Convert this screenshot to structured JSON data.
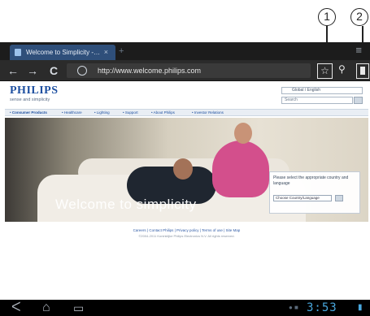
{
  "callouts": [
    "1",
    "2"
  ],
  "browser": {
    "tab_title": "Welcome to Simplicity -…",
    "tab_close": "×",
    "new_tab": "+",
    "overflow": "≡",
    "back": "←",
    "forward": "→",
    "reload": "C",
    "url": "http://www.welcome.philips.com",
    "bookmark_star": "☆",
    "search": "⚲"
  },
  "page": {
    "logo": "PHILIPS",
    "tagline": "sense and simplicity",
    "country_select": "Global / English",
    "search_placeholder": "Search",
    "nav": [
      "• Consumer Products",
      "• Healthcare",
      "• Lighting",
      "• Support",
      "• About Philips",
      "• Investor Relations"
    ],
    "headline": "Welcome to simplicity",
    "select_message": "Please select the appropriate country and language",
    "select_country": "Choose Country/Language",
    "footer_links": "Careers | Contact Philips | Privacy policy | Terms of use | Site Map",
    "footer_copy": "©2004-2011 Koninklijke Philips Electronics N.V. All rights reserved."
  },
  "system_bar": {
    "back": "ᐸ",
    "home": "⌂",
    "recent": "▭",
    "time": "3:53"
  },
  "colors": {
    "brand": "#1d4fa0",
    "clock": "#49a8de",
    "tab_active": "#2f4f7a"
  }
}
